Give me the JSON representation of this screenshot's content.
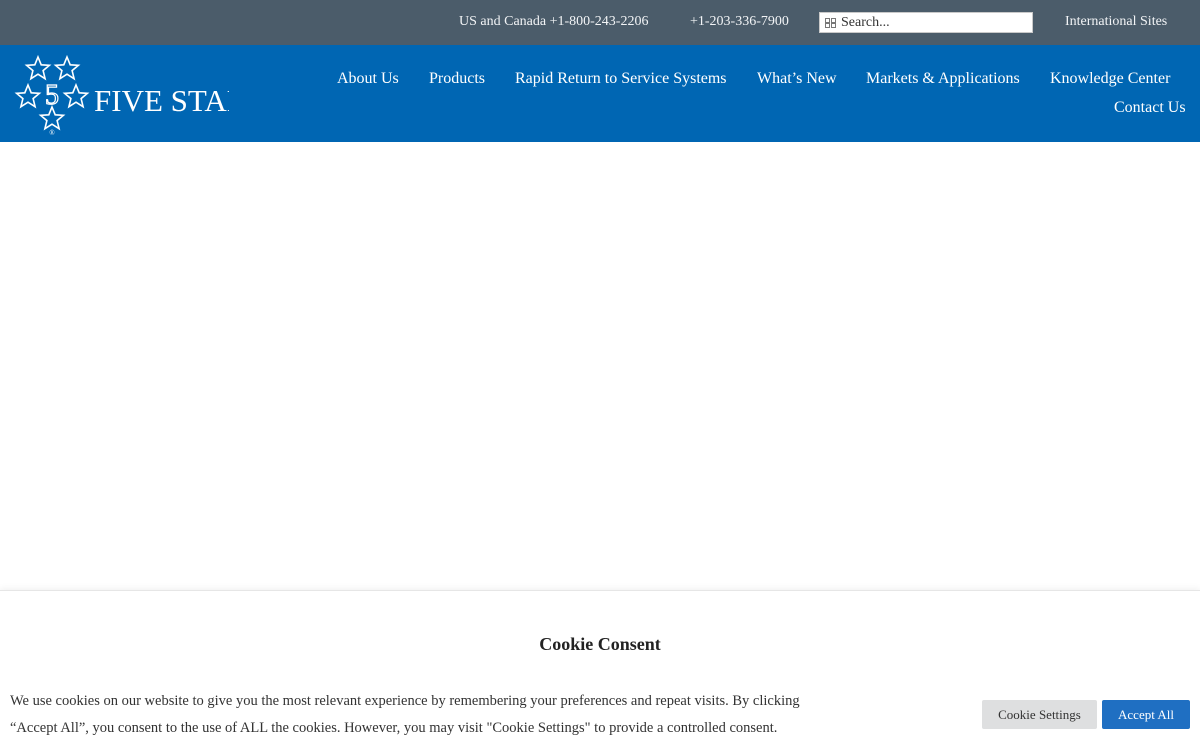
{
  "topbar": {
    "phone_us_canada": "US and Canada +1-800-243-2206",
    "phone_intl": "+1-203-336-7900",
    "search_placeholder": "Search...",
    "international_sites": "International Sites",
    "background_color": "#4b5c6a"
  },
  "logo": {
    "text": "FIVE STAR",
    "numeral": "5",
    "registered": "®"
  },
  "nav": {
    "background_color": "#0066b3",
    "items": [
      "About Us",
      "Products",
      "Rapid Return to Service Systems",
      "What’s New",
      "Markets & Applications",
      "Knowledge Center",
      "Contact Us"
    ]
  },
  "cookie_banner": {
    "title": "Cookie Consent",
    "text_line1": "We use cookies on our website to give you the most relevant experience by remembering your preferences and repeat visits. By clicking",
    "text_line2": "“Accept All”, you consent to the use of ALL the cookies. However, you may visit \"Cookie Settings\" to provide a controlled consent.",
    "settings_label": "Cookie Settings",
    "accept_label": "Accept All",
    "accent_color": "#1f6fc2"
  }
}
